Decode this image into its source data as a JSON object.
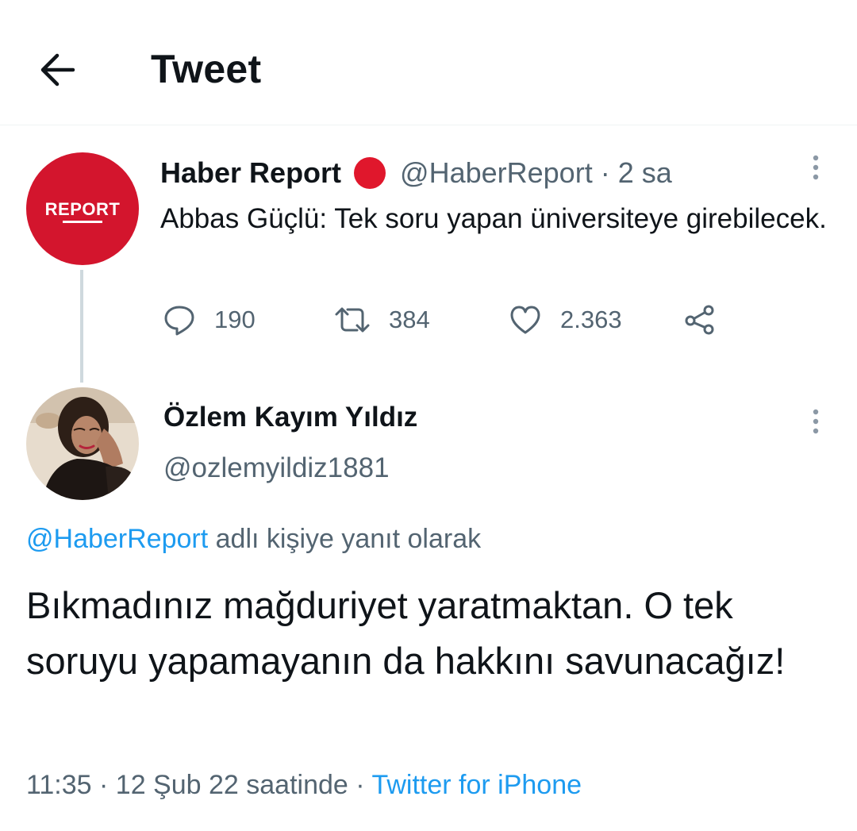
{
  "header": {
    "title": "Tweet",
    "back_icon": "arrow-left-icon"
  },
  "parent_tweet": {
    "author_name": "Haber Report",
    "avatar_logo_text": "REPORT",
    "avatar_color": "#d3152d",
    "badge_color": "#e0172c",
    "handle": "@HaberReport",
    "separator": "·",
    "time": "2 sa",
    "text": "Abbas Güçlü: Tek soru yapan üniversiteye girebilecek.",
    "actions": {
      "replies": "190",
      "retweets": "384",
      "likes": "2.363"
    }
  },
  "reply_tweet": {
    "author_name": "Özlem Kayım Yıldız",
    "handle": "@ozlemyildiz1881",
    "reply_to_mention": "@HaberReport",
    "reply_to_suffix": "adlı kişiye yanıt olarak",
    "text": "Bıkmadınız mağduriyet yaratmaktan. O tek soruyu yapamayanın da hakkını savunacağız!",
    "time": "11:35",
    "separator1": "·",
    "date": "12 Şub 22 saatinde",
    "separator2": "·",
    "source": "Twitter for iPhone"
  },
  "colors": {
    "link": "#1d9bf0",
    "secondary_text": "#536471",
    "primary_text": "#0f1419"
  }
}
